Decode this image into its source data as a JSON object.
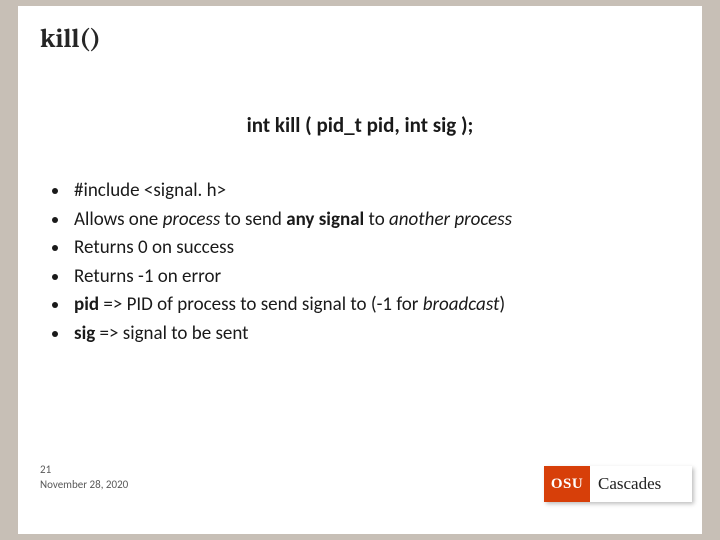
{
  "title": "kill()",
  "signature": "int kill ( pid_t pid, int sig );",
  "bullets": [
    {
      "segments": [
        {
          "t": "#include <signal. h>"
        }
      ]
    },
    {
      "segments": [
        {
          "t": "Allows one "
        },
        {
          "t": "process",
          "i": true
        },
        {
          "t": " to send "
        },
        {
          "t": "any signal",
          "b": true
        },
        {
          "t": " to "
        },
        {
          "t": "another process",
          "i": true
        }
      ]
    },
    {
      "segments": [
        {
          "t": "Returns 0 on success"
        }
      ]
    },
    {
      "segments": [
        {
          "t": "Returns -1 on error"
        }
      ]
    },
    {
      "segments": [
        {
          "t": "pid",
          "b": true
        },
        {
          "t": " => PID of process to send signal to (-1 for "
        },
        {
          "t": "broadcast",
          "i": true
        },
        {
          "t": ")"
        }
      ]
    },
    {
      "segments": [
        {
          "t": "sig",
          "b": true
        },
        {
          "t": "  => signal to be sent"
        }
      ]
    }
  ],
  "footer": {
    "slide_number": "21",
    "date": "November 28, 2020"
  },
  "logo": {
    "badge": "OSU",
    "text": "Cascades"
  }
}
